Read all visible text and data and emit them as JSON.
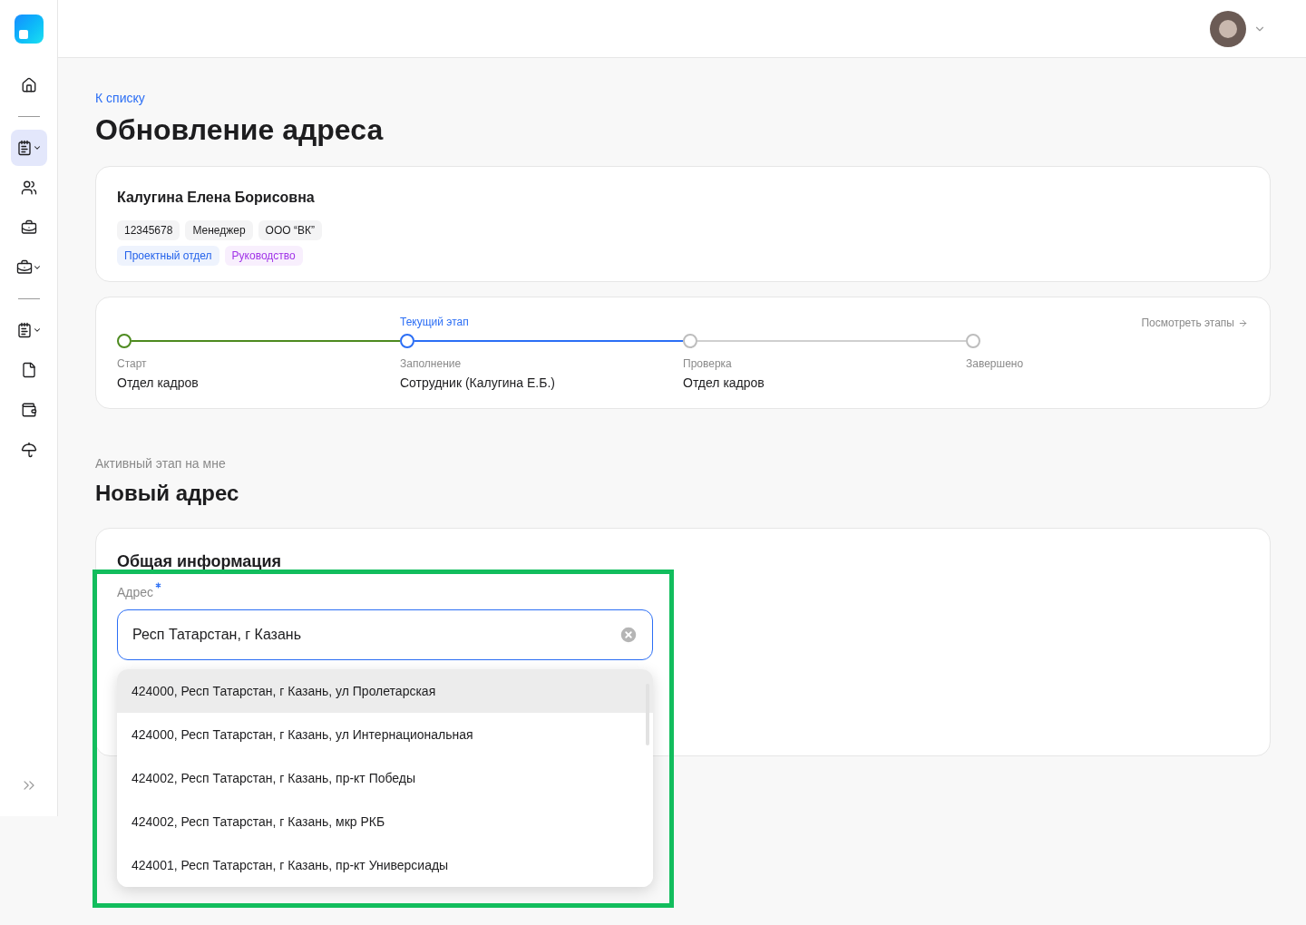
{
  "sidebar": {
    "items": [
      {
        "kind": "home",
        "selected": false,
        "has_menu": false
      },
      {
        "kind": "divider"
      },
      {
        "kind": "document",
        "selected": true,
        "has_menu": true
      },
      {
        "kind": "users",
        "selected": false,
        "has_menu": false
      },
      {
        "kind": "briefcase",
        "selected": false,
        "has_menu": false
      },
      {
        "kind": "briefcase",
        "selected": false,
        "has_menu": true
      },
      {
        "kind": "divider"
      },
      {
        "kind": "document",
        "selected": false,
        "has_menu": true
      },
      {
        "kind": "file",
        "selected": false,
        "has_menu": false
      },
      {
        "kind": "wallet",
        "selected": false,
        "has_menu": false
      },
      {
        "kind": "umbrella",
        "selected": false,
        "has_menu": false
      }
    ]
  },
  "back_link": "К списку",
  "title": "Обновление адреса",
  "employee": {
    "name": "Калугина Елена Борисовна",
    "tags": [
      {
        "label": "12345678",
        "color": "#f4f4f5"
      },
      {
        "label": "Менеджер",
        "color": "#f4f4f5"
      },
      {
        "label": "ООО “ВК”",
        "color": "#f4f4f5"
      }
    ],
    "departments": [
      {
        "label": "Проектный отдел",
        "color": "#2563eb"
      },
      {
        "label": "Руководство",
        "color": "#a033e8"
      }
    ]
  },
  "stages": {
    "link": "Посмотреть этапы",
    "steps": [
      {
        "completed": true,
        "current": false,
        "caption": "Старт",
        "owner": "Отдел кадров"
      },
      {
        "completed": false,
        "current": true,
        "top_label": "Текущий этап",
        "caption": "Заполнение",
        "owner": "Сотрудник (Калугина Е.Б.)"
      },
      {
        "completed": false,
        "current": false,
        "caption": "Проверка",
        "owner": "Отдел кадров"
      },
      {
        "completed": false,
        "current": false,
        "caption": "Завершено"
      }
    ]
  },
  "section": {
    "overline": "Активный этап на мне",
    "title": "Новый адрес"
  },
  "form": {
    "title": "Общая информация",
    "field": {
      "label": "Адрес",
      "required": true,
      "value": "Респ Татарстан, г Казань"
    },
    "suggestions": [
      {
        "text": "424000, Респ Татарстан, г Казань, ул Пролетарская",
        "highlighted": true
      },
      {
        "text": "424000, Респ Татарстан, г Казань, ул Интернациональная",
        "highlighted": false
      },
      {
        "text": "424002, Респ Татарстан, г Казань, пр-кт Победы",
        "highlighted": false
      },
      {
        "text": "424002, Респ Татарстан, г Казань, мкр РКБ",
        "highlighted": false
      },
      {
        "text": "424001, Респ Татарстан, г Казань, пр-кт Универсиады",
        "highlighted": false
      }
    ]
  }
}
